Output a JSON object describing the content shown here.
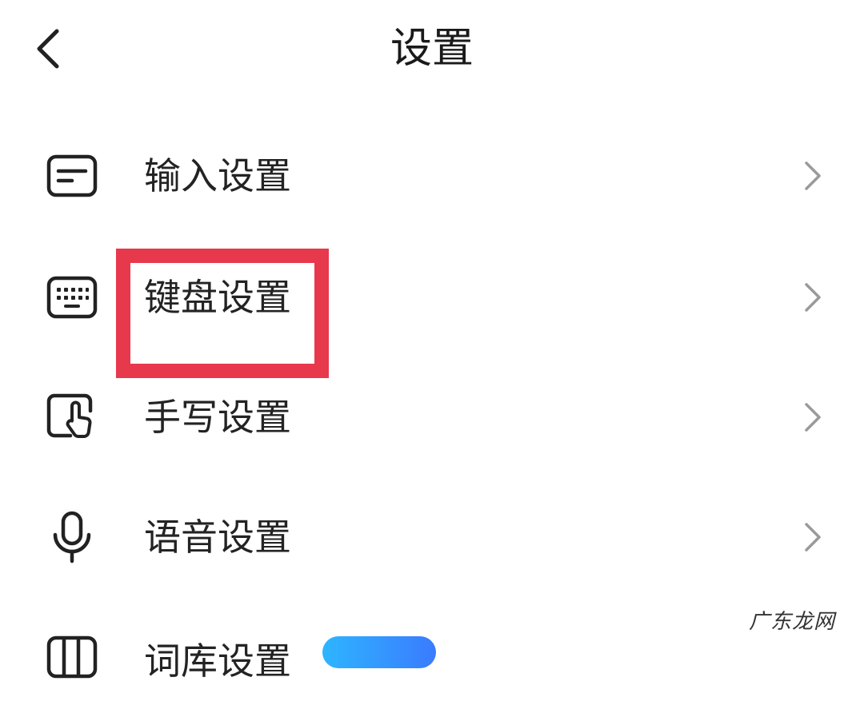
{
  "header": {
    "title": "设置",
    "back_icon": "chevron-left-icon"
  },
  "rows": [
    {
      "label": "输入设置",
      "icon": "input-box-icon"
    },
    {
      "label": "键盘设置",
      "icon": "keyboard-icon",
      "highlighted": true
    },
    {
      "label": "手写设置",
      "icon": "handwriting-touch-icon"
    },
    {
      "label": "语音设置",
      "icon": "microphone-icon"
    },
    {
      "label": "词库设置",
      "icon": "dictionary-icon",
      "badge": ""
    }
  ],
  "colors": {
    "highlight": "#e8384c",
    "chevron": "#9a9a9a",
    "icon": "#222222",
    "badge": "#2eb5ff"
  },
  "watermark": "广东龙网"
}
